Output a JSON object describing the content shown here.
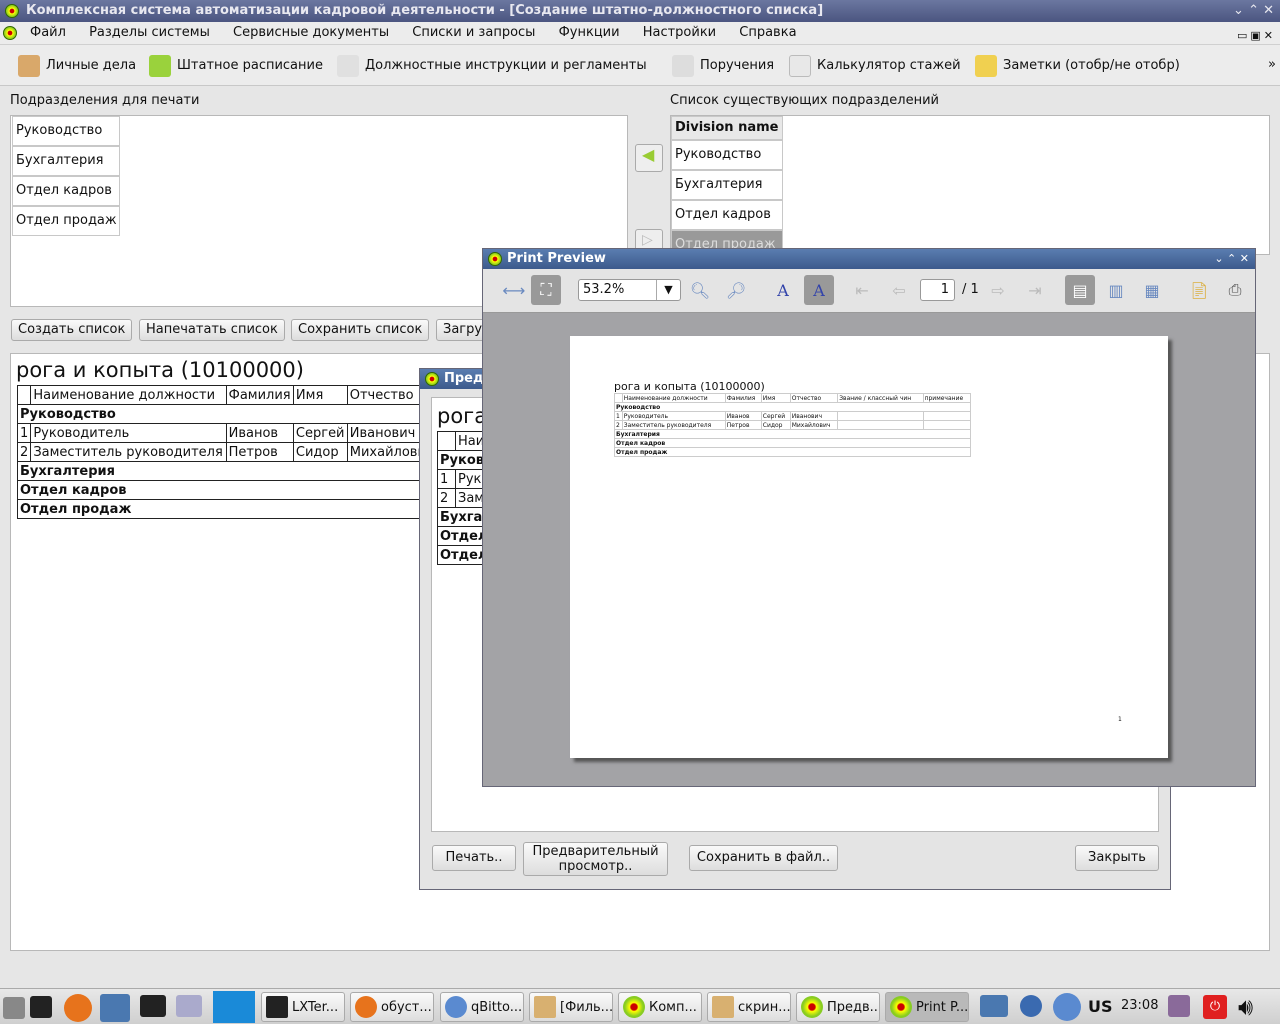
{
  "app": {
    "title": "Комплексная система автоматизации кадровой деятельности - [Создание штатно-должностного списка]"
  },
  "menu": [
    "Файл",
    "Разделы системы",
    "Сервисные документы",
    "Списки и запросы",
    "Функции",
    "Настройки",
    "Справка"
  ],
  "toolbar": [
    {
      "label": "Личные дела",
      "icon": "people-icon"
    },
    {
      "label": "Штатное расписание",
      "icon": "book-icon"
    },
    {
      "label": "Должностные инструкции и регламенты",
      "icon": "magnifier-icon"
    },
    {
      "label": "Поручения",
      "icon": "pen-icon"
    },
    {
      "label": "Калькулятор стажей",
      "icon": "calculator-icon"
    },
    {
      "label": "Заметки (отобр/не отобр)",
      "icon": "notes-icon"
    }
  ],
  "left_panel": {
    "label": "Подразделения для печати",
    "items": [
      "Руководство",
      "Бухгалтерия",
      "Отдел кадров",
      "Отдел продаж"
    ]
  },
  "right_panel": {
    "label": "Список существующих подразделений",
    "header": "Division name",
    "items": [
      "Руководство",
      "Бухгалтерия",
      "Отдел кадров",
      "Отдел продаж"
    ]
  },
  "buttons": {
    "create": "Создать список",
    "print": "Напечатать список",
    "save": "Сохранить список",
    "load": "Загру"
  },
  "report": {
    "title": "рога и копыта (10100000)",
    "headers": [
      "Наименование должности",
      "Фамилия",
      "Имя",
      "Отчество",
      "Звание / классный чин",
      "примечание"
    ],
    "rows": [
      {
        "type": "group",
        "name": "Руководство"
      },
      {
        "type": "row",
        "n": "1",
        "pos": "Руководитель",
        "last": "Иванов",
        "first": "Сергей",
        "middle": "Иванович"
      },
      {
        "type": "row",
        "n": "2",
        "pos": "Заместитель руководителя",
        "last": "Петров",
        "first": "Сидор",
        "middle": "Михайлович"
      },
      {
        "type": "group",
        "name": "Бухгалтерия"
      },
      {
        "type": "group",
        "name": "Отдел кадров"
      },
      {
        "type": "group",
        "name": "Отдел продаж"
      }
    ]
  },
  "dialog": {
    "title": "Пред",
    "title_partial": "рога",
    "col_partial": "Наи",
    "row_partials": [
      "Руков",
      "Рук",
      "Зам",
      "Бухга",
      "Отдел",
      "Отдел"
    ],
    "print": "Печать..",
    "preview": "Предварительный просмотр..",
    "save_file": "Сохранить в файл..",
    "close": "Закрыть"
  },
  "print_preview": {
    "title": "Print Preview",
    "zoom": "53.2%",
    "page": "1",
    "page_total": "/ 1",
    "page_number": "1"
  },
  "taskbar": {
    "tasks": [
      "LXTer...",
      "обуст...",
      "qBitto...",
      "[Филь...",
      "Комп...",
      "скрин...",
      "Предв...",
      "Print P..."
    ],
    "layout": "US",
    "time": "23:08"
  }
}
